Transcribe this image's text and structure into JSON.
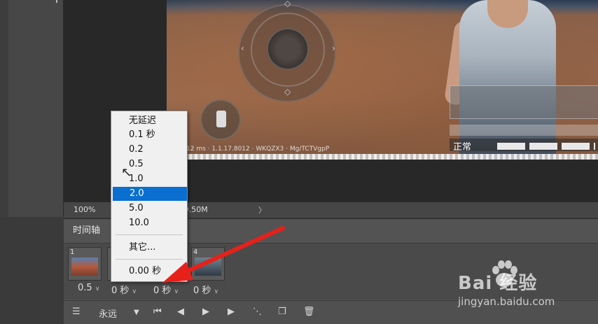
{
  "canvas": {
    "watermark_line": "12 ms · 1.1.17.8012 · WKQZX3 · Mg/TCTVgpP",
    "status_label": "正常"
  },
  "statusbar": {
    "zoom": "100%",
    "doc_size": "/9.50M",
    "arrow": "〉"
  },
  "timeline": {
    "tab_label": "时间轴",
    "frames": [
      {
        "number": "1",
        "delay": "0.5"
      },
      {
        "number": "",
        "delay": "0 秒"
      },
      {
        "number": "",
        "delay": "0 秒"
      },
      {
        "number": "4",
        "delay": "0 秒"
      }
    ],
    "loop_label": "永远"
  },
  "frame_delay_menu": {
    "items": [
      "无延迟",
      "0.1 秒",
      "0.2",
      "0.5",
      "1.0",
      "2.0",
      "5.0",
      "10.0"
    ],
    "selected": "2.0",
    "other_label": "其它...",
    "current_value": "0.00 秒"
  },
  "watermark": {
    "brand": "Bai  经验",
    "url": "jingyan.baidu.com"
  },
  "colors": {
    "menu_highlight": "#0a6fd0",
    "annotation_arrow": "#e8201a",
    "panel_bg": "#535353"
  },
  "icons": {
    "timeline_options": "timeline-options-icon",
    "first_frame": "first-frame-icon",
    "prev_frame": "previous-frame-icon",
    "play": "play-icon",
    "next_frame": "next-frame-icon",
    "tween": "tween-icon",
    "duplicate_frame": "duplicate-frame-icon",
    "delete_frame": "trash-icon"
  }
}
